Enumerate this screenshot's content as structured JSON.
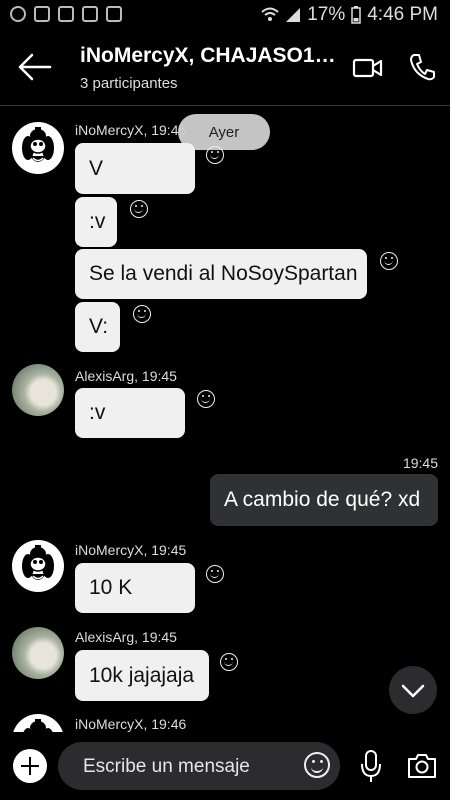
{
  "status_bar": {
    "battery": "17%",
    "time": "4:46 PM"
  },
  "header": {
    "title": "iNoMercyX, CHAJASO1…",
    "subtitle": "3 participantes"
  },
  "date_pill": "Ayer",
  "messages": [
    {
      "sender": "iNoMercyX, 19:45",
      "text": "V"
    },
    {
      "text": ":v"
    },
    {
      "text": "Se la vendi al NoSoySpartan"
    },
    {
      "text": "V:"
    },
    {
      "sender": "AlexisArg, 19:45",
      "text": ":v"
    },
    {
      "time": "19:45",
      "text": "A cambio de qué? xd"
    },
    {
      "sender": "iNoMercyX, 19:45",
      "text": "10 K"
    },
    {
      "sender": "AlexisArg, 19:45",
      "text": "10k jajajaja"
    },
    {
      "sender": "iNoMercyX, 19:46"
    }
  ],
  "composer": {
    "placeholder": "Escribe un mensaje"
  }
}
